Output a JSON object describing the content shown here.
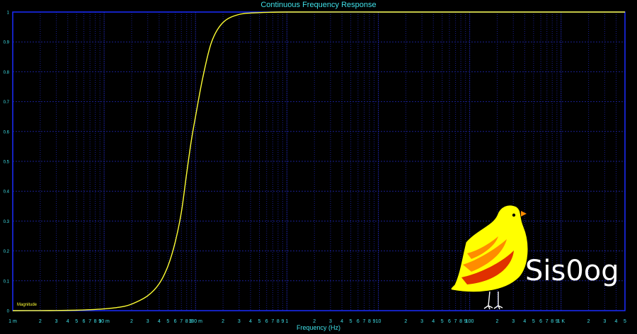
{
  "chart_data": {
    "type": "line",
    "title": "Continuous Frequency Response",
    "xlabel": "Frequency (Hz)",
    "ylabel": "Magnitude",
    "x_scale": "log",
    "xlim": [
      0.001,
      5000
    ],
    "ylim": [
      0,
      1
    ],
    "grid": true,
    "x_major_ticks": [
      {
        "value": 0.001,
        "label": "1 m"
      },
      {
        "value": 0.01,
        "label": "10 m"
      },
      {
        "value": 0.1,
        "label": "100 m"
      },
      {
        "value": 1,
        "label": "1"
      },
      {
        "value": 10,
        "label": "10"
      },
      {
        "value": 100,
        "label": "100"
      },
      {
        "value": 1000,
        "label": "1 K"
      }
    ],
    "x_minor_labels": [
      "2",
      "3",
      "4",
      "5",
      "6",
      "7",
      "8",
      "9"
    ],
    "y_ticks": [
      {
        "value": 0,
        "label": "0"
      },
      {
        "value": 0.1,
        "label": "0.1"
      },
      {
        "value": 0.2,
        "label": "0.2"
      },
      {
        "value": 0.3,
        "label": "0.3"
      },
      {
        "value": 0.4,
        "label": "0.4"
      },
      {
        "value": 0.5,
        "label": "0.5"
      },
      {
        "value": 0.6,
        "label": "0.6"
      },
      {
        "value": 0.7,
        "label": "0.7"
      },
      {
        "value": 0.8,
        "label": "0.8"
      },
      {
        "value": 0.9,
        "label": "0.9"
      },
      {
        "value": 1,
        "label": "1"
      }
    ],
    "series": [
      {
        "name": "",
        "color": "#ffff33",
        "points": [
          {
            "x": 0.001,
            "y": 0.0
          },
          {
            "x": 0.002,
            "y": 0.0002
          },
          {
            "x": 0.003,
            "y": 0.0005
          },
          {
            "x": 0.005,
            "y": 0.0015
          },
          {
            "x": 0.007,
            "y": 0.003
          },
          {
            "x": 0.01,
            "y": 0.006
          },
          {
            "x": 0.015,
            "y": 0.012
          },
          {
            "x": 0.02,
            "y": 0.022
          },
          {
            "x": 0.03,
            "y": 0.05
          },
          {
            "x": 0.04,
            "y": 0.09
          },
          {
            "x": 0.05,
            "y": 0.15
          },
          {
            "x": 0.06,
            "y": 0.23
          },
          {
            "x": 0.07,
            "y": 0.33
          },
          {
            "x": 0.08,
            "y": 0.46
          },
          {
            "x": 0.09,
            "y": 0.57
          },
          {
            "x": 0.1,
            "y": 0.65
          },
          {
            "x": 0.12,
            "y": 0.78
          },
          {
            "x": 0.15,
            "y": 0.9
          },
          {
            "x": 0.2,
            "y": 0.965
          },
          {
            "x": 0.3,
            "y": 0.992
          },
          {
            "x": 0.5,
            "y": 0.998
          },
          {
            "x": 1,
            "y": 1.0
          },
          {
            "x": 10,
            "y": 1.0
          },
          {
            "x": 100,
            "y": 1.0
          },
          {
            "x": 1000,
            "y": 1.0
          },
          {
            "x": 5000,
            "y": 1.0
          }
        ]
      }
    ]
  },
  "logo": {
    "text": "Sis0og",
    "body_color": "#ffff00",
    "stripe_colors": [
      "#ff8c00",
      "#e03000"
    ]
  },
  "colors": {
    "background": "#000000",
    "frame": "#1a2cff",
    "grid": "#1a2090",
    "text": "#40e0e8",
    "curve": "#ffff33"
  }
}
